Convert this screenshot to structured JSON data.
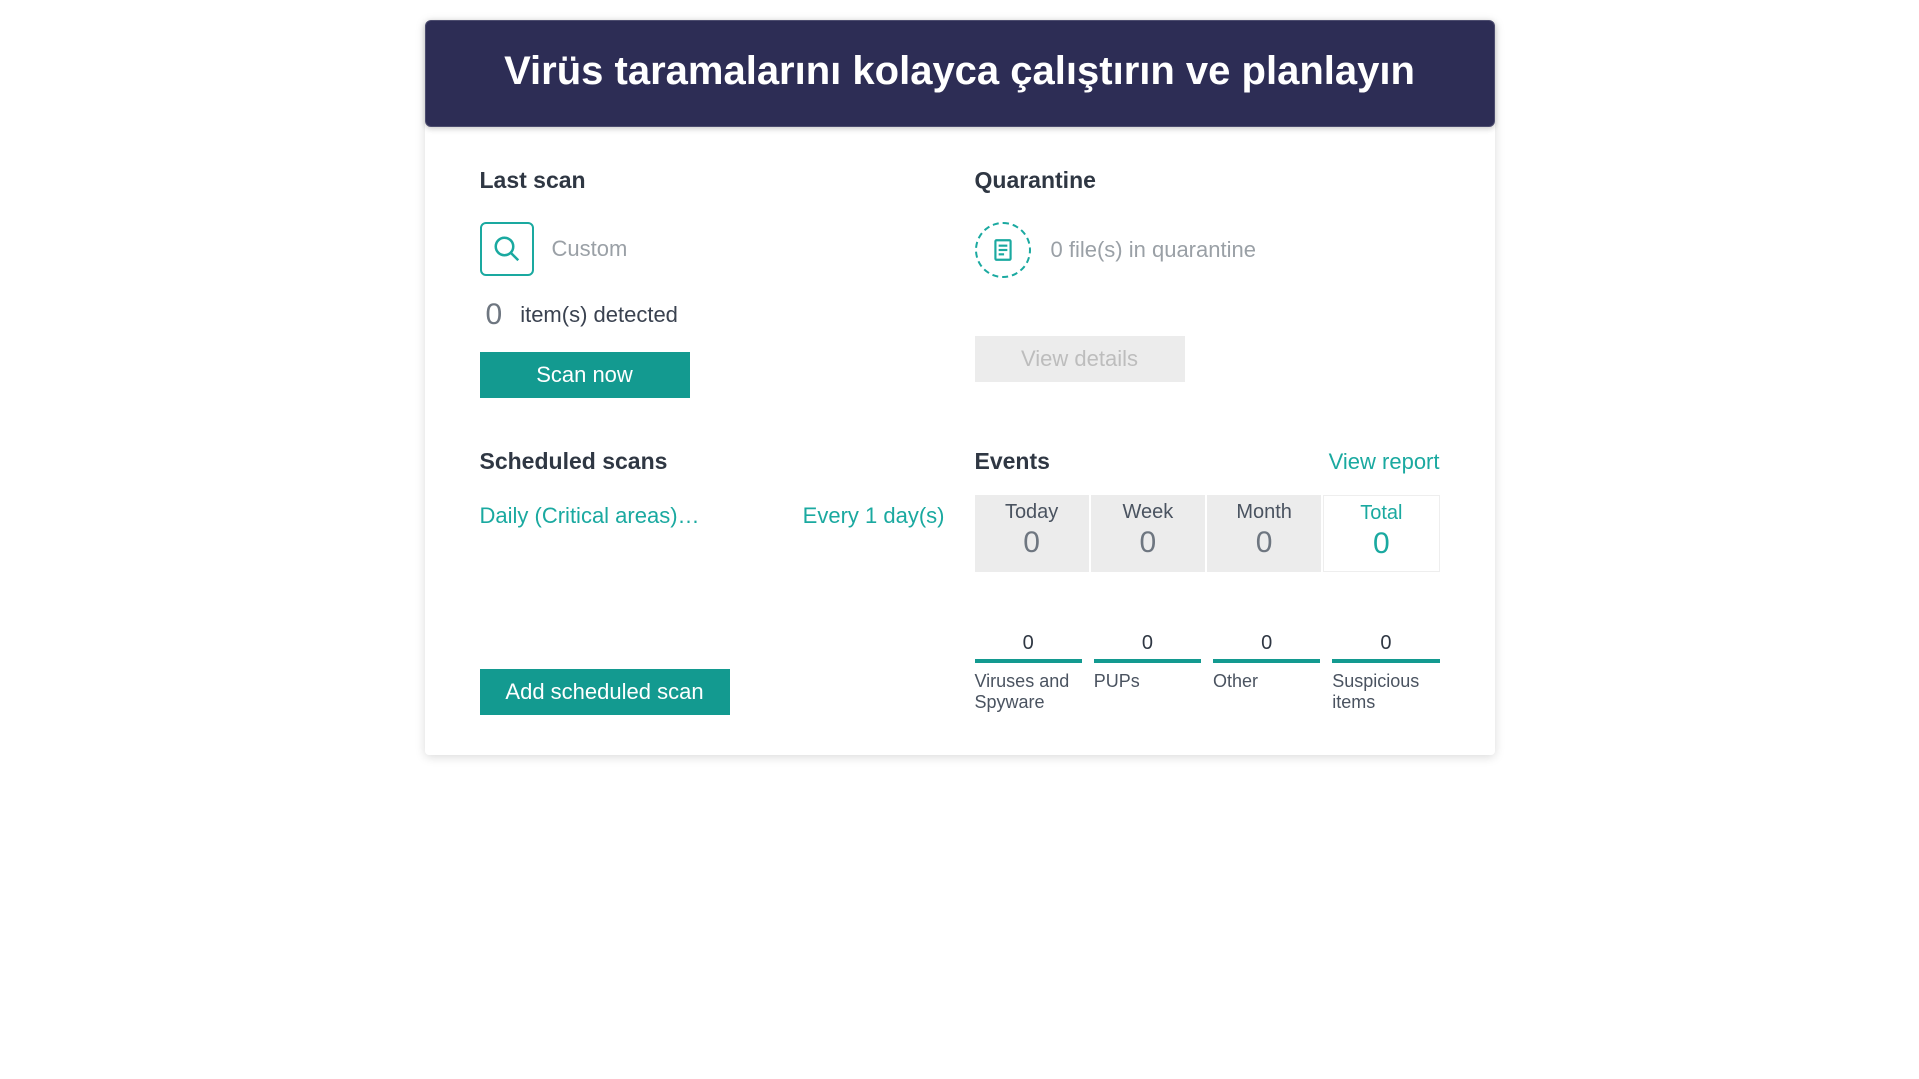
{
  "banner": {
    "title": "Virüs taramalarını kolayca çalıştırın ve planlayın"
  },
  "last_scan": {
    "heading": "Last scan",
    "scan_type": "Custom",
    "detected_count": "0",
    "detected_text": "item(s) detected",
    "scan_now_label": "Scan now"
  },
  "quarantine": {
    "heading": "Quarantine",
    "status_text": "0 file(s) in quarantine",
    "view_details_label": "View details"
  },
  "scheduled": {
    "heading": "Scheduled scans",
    "item_name": "Daily (Critical areas)…",
    "item_freq": "Every 1 day(s)",
    "add_label": "Add scheduled scan"
  },
  "events": {
    "heading": "Events",
    "view_report": "View report",
    "tabs": [
      {
        "label": "Today",
        "value": "0"
      },
      {
        "label": "Week",
        "value": "0"
      },
      {
        "label": "Month",
        "value": "0"
      },
      {
        "label": "Total",
        "value": "0"
      }
    ],
    "categories": [
      {
        "count": "0",
        "label": "Viruses and Spyware"
      },
      {
        "count": "0",
        "label": "PUPs"
      },
      {
        "count": "0",
        "label": "Other"
      },
      {
        "count": "0",
        "label": "Suspicious items"
      }
    ]
  }
}
